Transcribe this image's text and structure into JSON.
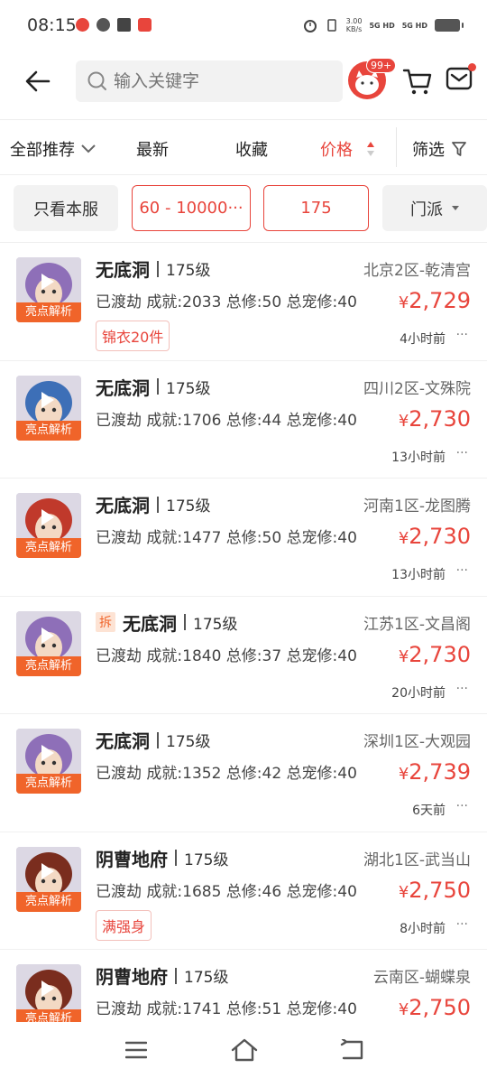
{
  "status_bar": {
    "time": "08:15",
    "net_speed_value": "3.00",
    "net_speed_unit": "KB/s",
    "signal1": "5G HD",
    "signal2": "5G HD"
  },
  "header": {
    "search_placeholder": "输入关键字",
    "avatar_badge": "99+"
  },
  "sort_bar": {
    "items": [
      "全部推荐",
      "最新",
      "收藏",
      "价格",
      "筛选"
    ],
    "active": "价格"
  },
  "filters": {
    "server_only": "只看本服",
    "price_range": "60 - 10000···",
    "level": "175",
    "school": "门派"
  },
  "listings": [
    {
      "title": "无底洞",
      "level": "175级",
      "server": "北京2区-乾清宫",
      "stats": "已渡劫 成就:2033 总修:50 总宠修:40",
      "price": "2,729",
      "time": "4小时前",
      "tag": "锦衣20件",
      "tear_down": false,
      "badge": "亮点解析"
    },
    {
      "title": "无底洞",
      "level": "175级",
      "server": "四川2区-文殊院",
      "stats": "已渡劫 成就:1706 总修:44 总宠修:40",
      "price": "2,730",
      "time": "13小时前",
      "tag": "",
      "tear_down": false,
      "badge": "亮点解析"
    },
    {
      "title": "无底洞",
      "level": "175级",
      "server": "河南1区-龙图腾",
      "stats": "已渡劫 成就:1477 总修:50 总宠修:40",
      "price": "2,730",
      "time": "13小时前",
      "tag": "",
      "tear_down": false,
      "badge": "亮点解析"
    },
    {
      "title": "无底洞",
      "level": "175级",
      "server": "江苏1区-文昌阁",
      "stats": "已渡劫 成就:1840 总修:37 总宠修:40",
      "price": "2,730",
      "time": "20小时前",
      "tag": "",
      "tear_down": true,
      "badge": "亮点解析"
    },
    {
      "title": "无底洞",
      "level": "175级",
      "server": "深圳1区-大观园",
      "stats": "已渡劫 成就:1352 总修:42 总宠修:40",
      "price": "2,739",
      "time": "6天前",
      "tag": "",
      "tear_down": false,
      "badge": "亮点解析"
    },
    {
      "title": "阴曹地府",
      "level": "175级",
      "server": "湖北1区-武当山",
      "stats": "已渡劫 成就:1685 总修:46 总宠修:40",
      "price": "2,750",
      "time": "8小时前",
      "tag": "满强身",
      "tear_down": false,
      "badge": "亮点解析"
    },
    {
      "title": "阴曹地府",
      "level": "175级",
      "server": "云南区-蝴蝶泉",
      "stats": "已渡劫 成就:1741 总修:51 总宠修:40",
      "price": "2,750",
      "time": "",
      "tag": "",
      "tear_down": false,
      "badge": "亮点解析"
    }
  ],
  "labels": {
    "tear_down_badge": "拆",
    "currency": "¥",
    "more": "···"
  },
  "colors": {
    "accent": "#e8453c",
    "badge_orange": "#f0642a"
  }
}
